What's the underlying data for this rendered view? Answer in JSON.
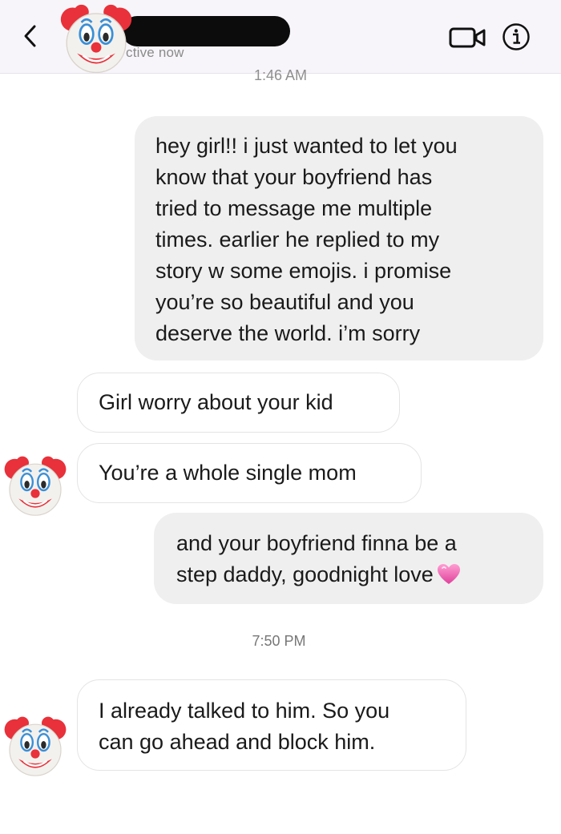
{
  "header": {
    "status": "ctive now",
    "icons": {
      "back": "chevron-left-icon",
      "video": "video-call-icon",
      "info": "info-icon",
      "avatar": "clown-emoji-avatar"
    }
  },
  "thread": {
    "timestamp_top": "1:46 AM",
    "messages": [
      {
        "direction": "sent",
        "text": "hey girl!! i just wanted to let you\nknow that your boyfriend has\ntried to message me multiple\ntimes. earlier he replied to my\nstory w some emojis. i promise\nyou’re so beautiful and you\ndeserve the world. i’m sorry"
      },
      {
        "direction": "received",
        "text": "Girl worry about your kid"
      },
      {
        "direction": "received",
        "text": "You’re a whole single mom"
      },
      {
        "direction": "sent",
        "text": "and your boyfriend finna be a\nstep daddy, goodnight love",
        "emoji": "pink-heart-emoji"
      },
      {
        "direction": "received",
        "text": "I already talked to him. So you\ncan go ahead and block him."
      }
    ],
    "timestamp_mid": "7:50 PM"
  },
  "colors": {
    "header_bg": "#f8f5fa",
    "sent_bubble": "#efefef",
    "received_border": "#e4e4e4",
    "text": "#1a1a1a",
    "timestamp": "#8f8f8f",
    "clown_red": "#e8313a",
    "clown_face": "#f3f1ee"
  }
}
